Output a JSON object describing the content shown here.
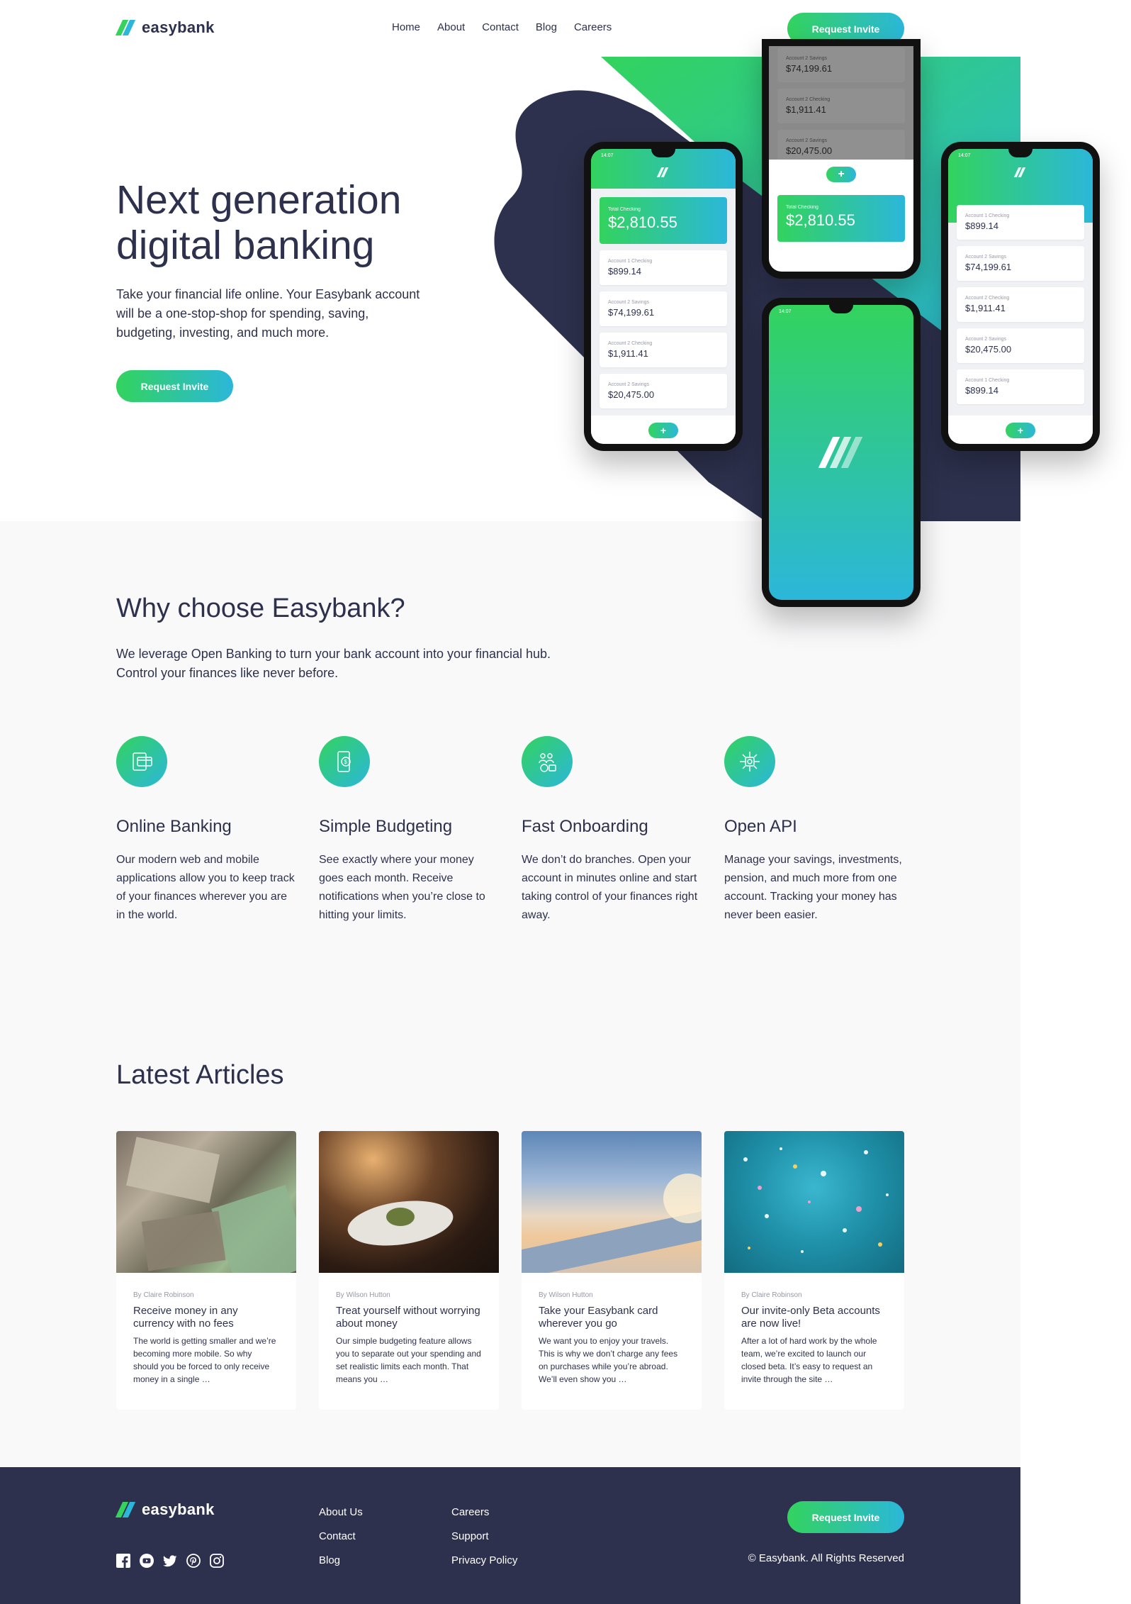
{
  "brand": {
    "name": "easybank",
    "accent_green": "#33d35e",
    "accent_cyan": "#2bb7da",
    "dark": "#2d314d"
  },
  "nav": {
    "links": [
      "Home",
      "About",
      "Contact",
      "Blog",
      "Careers"
    ],
    "cta": "Request Invite"
  },
  "hero": {
    "title_line1": "Next generation",
    "title_line2": "digital banking",
    "text": "Take your financial life online. Your Easybank account will be a one-stop-shop for spending, saving, budgeting, investing, and much more.",
    "cta": "Request Invite"
  },
  "phones": {
    "time": "14:07",
    "total_label": "Total Checking",
    "total_amount": "$2,810.55",
    "accounts": [
      {
        "label": "Account 1 Checking",
        "amount": "$899.14"
      },
      {
        "label": "Account 2 Savings",
        "amount": "$74,199.61"
      },
      {
        "label": "Account 2 Checking",
        "amount": "$1,911.41"
      },
      {
        "label": "Account 2 Savings",
        "amount": "$20,475.00"
      },
      {
        "label": "Account 1 Checking",
        "amount": "$899.14"
      }
    ],
    "plus": "+"
  },
  "why": {
    "title": "Why choose Easybank?",
    "text_line1": "We leverage Open Banking to turn your bank account into your financial hub.",
    "text_line2": "Control your finances like never before.",
    "features": [
      {
        "icon": "online-banking-icon",
        "title": "Online Banking",
        "text": "Our modern web and mobile applications allow you to keep track of your finances wherever you are in the world."
      },
      {
        "icon": "budgeting-icon",
        "title": "Simple Budgeting",
        "text": "See exactly where your money goes each month. Receive notifications when you’re close to hitting your limits."
      },
      {
        "icon": "onboarding-icon",
        "title": "Fast Onboarding",
        "text": "We don’t do branches. Open your account in minutes online and start taking control of your finances right away."
      },
      {
        "icon": "api-icon",
        "title": "Open API",
        "text": "Manage your savings, investments, pension, and much more from one account. Tracking your money has never been easier."
      }
    ]
  },
  "articles": {
    "title": "Latest Articles",
    "items": [
      {
        "image": "currency",
        "author": "By Claire Robinson",
        "title": "Receive money in any currency with no fees",
        "excerpt": "The world is getting smaller and we’re becoming more mobile. So why should you be forced to only receive money in a single …"
      },
      {
        "image": "restaurant",
        "author": "By Wilson Hutton",
        "title": "Treat yourself without worrying about money",
        "excerpt": "Our simple budgeting feature allows you to separate out your spending and set realistic limits each month. That means you …"
      },
      {
        "image": "plane",
        "author": "By Wilson Hutton",
        "title": "Take your Easybank card wherever you go",
        "excerpt": "We want you to enjoy your travels. This is why we don’t charge any fees on purchases while you’re abroad. We’ll even show you …"
      },
      {
        "image": "confetti",
        "author": "By Claire Robinson",
        "title": "Our invite-only Beta accounts are now live!",
        "excerpt": "After a lot of hard work by the whole team, we’re excited to launch our closed beta. It’s easy to request an invite through the site …"
      }
    ]
  },
  "footer": {
    "social": [
      "facebook-icon",
      "youtube-icon",
      "twitter-icon",
      "pinterest-icon",
      "instagram-icon"
    ],
    "col1": [
      "About Us",
      "Contact",
      "Blog"
    ],
    "col2": [
      "Careers",
      "Support",
      "Privacy Policy"
    ],
    "cta": "Request Invite",
    "copyright": "© Easybank. All Rights Reserved"
  }
}
